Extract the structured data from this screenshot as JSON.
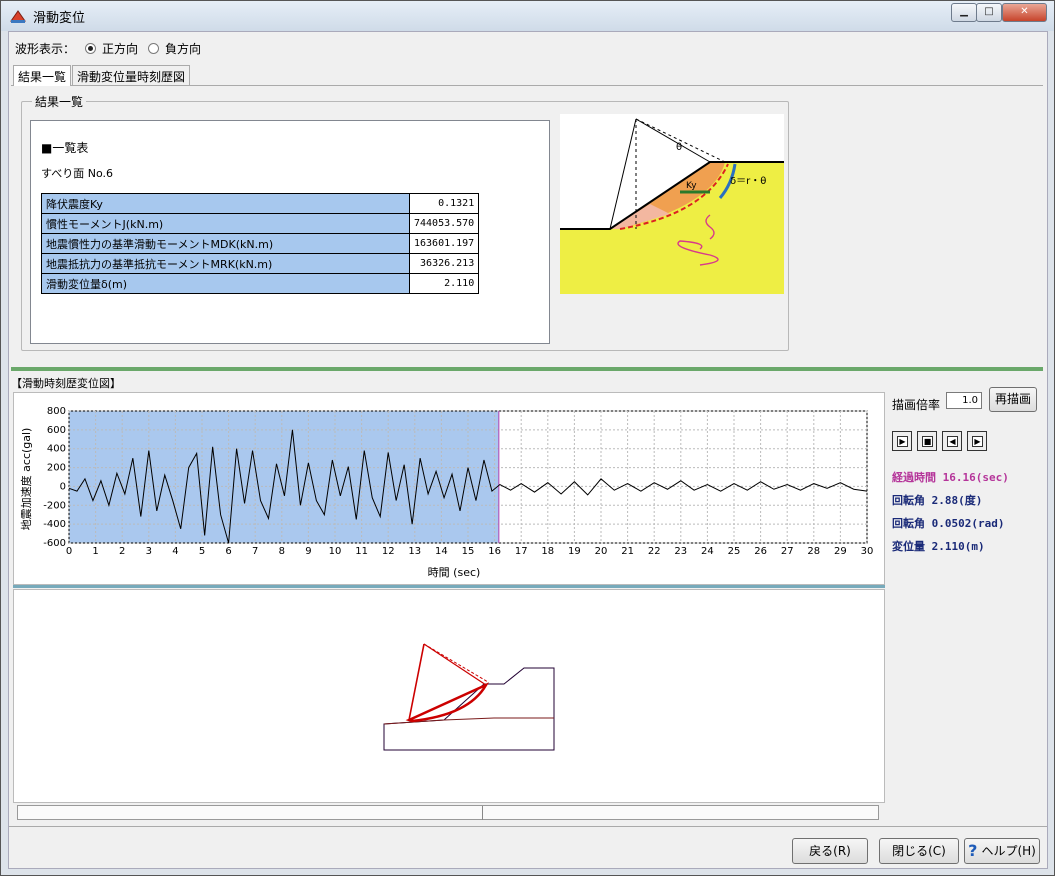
{
  "window": {
    "title": "滑動変位"
  },
  "wave_display": {
    "label": "波形表示：",
    "options": [
      {
        "label": "正方向",
        "selected": true
      },
      {
        "label": "負方向",
        "selected": false
      }
    ]
  },
  "tabs": [
    {
      "label": "結果一覧",
      "active": true
    },
    {
      "label": "滑動変位量時刻歴図",
      "active": false
    }
  ],
  "results": {
    "group_label": "結果一覧",
    "table_title": "■一覧表",
    "surface": "すべり面 No.6",
    "rows": [
      {
        "label": "降伏震度Ky",
        "value": "0.1321"
      },
      {
        "label": "慣性モーメントJ(kN.m)",
        "value": "744053.570"
      },
      {
        "label": "地震慣性力の基準滑動モーメントMDK(kN.m)",
        "value": "163601.197"
      },
      {
        "label": "地震抵抗力の基準抵抗モーメントMRK(kN.m)",
        "value": "36326.213"
      },
      {
        "label": "滑動変位量δ(m)",
        "value": "2.110"
      }
    ],
    "diagram": {
      "theta": "θ",
      "ky": "Ky",
      "delta": "δ＝r・θ"
    }
  },
  "history": {
    "title": "【滑動時刻歴変位図】",
    "zoom_label": "描画倍率",
    "zoom_value": "1.0",
    "redraw_label": "再描画",
    "elapsed": "経過時間 16.16(sec)",
    "rotation_deg": "回転角 2.88(度)",
    "rotation_rad": "回転角 0.0502(rad)",
    "displacement": "変位量 2.110(m)"
  },
  "chart_data": {
    "type": "line",
    "xlabel": "時間 (sec)",
    "ylabel": "地震加速度 acc(gal)",
    "xlim": [
      0,
      30
    ],
    "ylim": [
      -600,
      800
    ],
    "x_ticks": [
      0,
      1,
      2,
      3,
      4,
      5,
      6,
      7,
      8,
      9,
      10,
      11,
      12,
      13,
      14,
      15,
      16,
      17,
      18,
      19,
      20,
      21,
      22,
      23,
      24,
      25,
      26,
      27,
      28,
      29,
      30
    ],
    "y_ticks": [
      800,
      600,
      400,
      200,
      0,
      -200,
      -400,
      -600
    ],
    "highlight_until": 16.16,
    "series": [
      {
        "x": [
          0,
          0.3,
          0.6,
          0.9,
          1.2,
          1.5,
          1.8,
          2.1,
          2.4,
          2.7,
          3.0,
          3.3,
          3.6,
          3.9,
          4.2,
          4.5,
          4.8,
          5.1,
          5.4,
          5.7,
          6.0,
          6.3,
          6.6,
          6.9,
          7.2,
          7.5,
          7.8,
          8.1,
          8.4,
          8.7,
          9.0,
          9.3,
          9.6,
          9.9,
          10.2,
          10.5,
          10.8,
          11.1,
          11.4,
          11.7,
          12.0,
          12.3,
          12.6,
          12.9,
          13.2,
          13.5,
          13.8,
          14.1,
          14.4,
          14.7,
          15.0,
          15.3,
          15.6,
          15.9,
          16.2,
          16.6,
          17.0,
          17.5,
          18.0,
          18.5,
          19.0,
          19.5,
          20.0,
          20.5,
          21.0,
          21.5,
          22.0,
          22.5,
          23.0,
          23.5,
          24.0,
          24.5,
          25.0,
          25.5,
          26.0,
          26.5,
          27.0,
          27.5,
          28.0,
          28.5,
          29.0,
          29.5,
          30.0
        ],
        "y": [
          -20,
          -50,
          80,
          -150,
          60,
          -200,
          140,
          -80,
          300,
          -320,
          380,
          -260,
          120,
          -150,
          -450,
          200,
          350,
          -520,
          420,
          -300,
          -600,
          400,
          -180,
          380,
          -150,
          -340,
          240,
          -100,
          600,
          -200,
          250,
          -150,
          -300,
          280,
          -100,
          210,
          -350,
          380,
          -120,
          -320,
          360,
          -150,
          230,
          -400,
          300,
          -80,
          160,
          -120,
          130,
          -260,
          200,
          -150,
          280,
          -50,
          20,
          -40,
          30,
          -60,
          40,
          -80,
          50,
          -90,
          80,
          -40,
          30,
          -50,
          40,
          -30,
          60,
          -40,
          20,
          -50,
          30,
          -40,
          50,
          -30,
          20,
          -40,
          30,
          -20,
          40,
          -30,
          -50
        ]
      }
    ]
  },
  "footer": {
    "back_label": "戻る(R)",
    "close_label": "閉じる(C)",
    "help_label": "ヘルプ(H)"
  }
}
